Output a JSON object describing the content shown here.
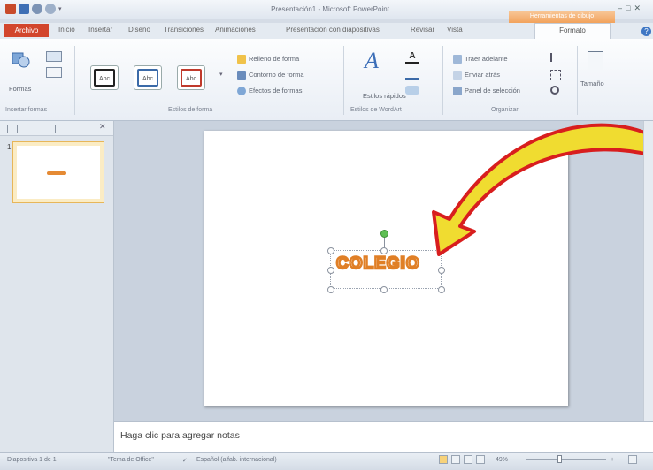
{
  "window": {
    "title": "Presentación1 - Microsoft PowerPoint",
    "context_tab_header": "Herramientas de dibujo",
    "controls": [
      "–",
      "□",
      "✕"
    ]
  },
  "tabs": {
    "file": "Archivo",
    "items": [
      "Inicio",
      "Insertar",
      "Diseño",
      "Transiciones",
      "Animaciones",
      "Presentación con diapositivas",
      "Revisar",
      "Vista"
    ],
    "format": "Formato"
  },
  "ribbon": {
    "insert_shapes": {
      "label": "Formas",
      "group": "Insertar formas"
    },
    "shape_styles": {
      "samples": [
        "Abc",
        "Abc",
        "Abc"
      ],
      "fill": "Relleno de forma",
      "outline": "Contorno de forma",
      "effects": "Efectos de formas",
      "group": "Estilos de forma"
    },
    "wordart": {
      "quick_styles": "Estilos rápidos",
      "group": "Estilos de WordArt"
    },
    "arrange": {
      "bring_forward": "Traer adelante",
      "send_backward": "Enviar atrás",
      "selection_pane": "Panel de selección",
      "group": "Organizar"
    },
    "size": {
      "label": "Tamaño"
    }
  },
  "slide": {
    "number": "1",
    "wordart_text": "COLEGIO"
  },
  "notes": {
    "placeholder": "Haga clic para agregar notas"
  },
  "status": {
    "slide_info": "Diapositiva 1 de 1",
    "theme": "\"Tema de Office\"",
    "language": "Español (alfab. internacional)",
    "zoom": "49%"
  },
  "colors": {
    "file_tab": "#d2452c",
    "wordart_outline": "#e07f26",
    "arrow_fill": "#f0dc30",
    "arrow_outline": "#d81e1e"
  }
}
